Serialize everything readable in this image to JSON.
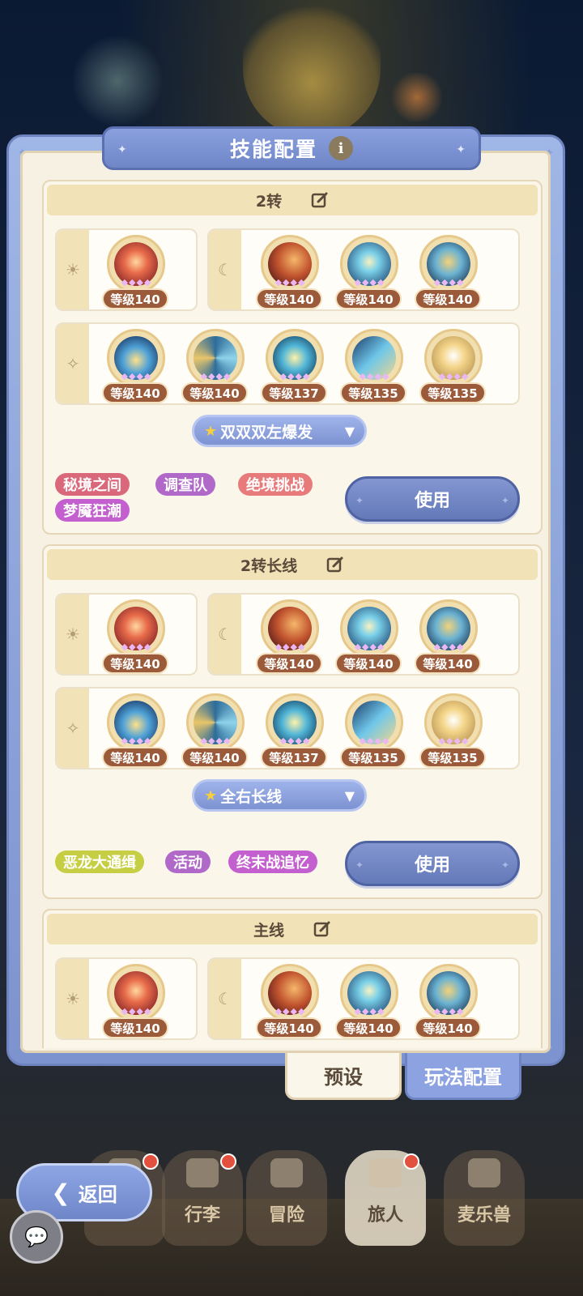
{
  "panel": {
    "title": "技能配置",
    "info_icon": "i"
  },
  "presets": [
    {
      "title": "2转",
      "row1_left": [
        {
          "type": "fire",
          "level": "等级140"
        }
      ],
      "row1_right": [
        {
          "type": "flame",
          "level": "等级140"
        },
        {
          "type": "ice",
          "level": "等级140"
        },
        {
          "type": "gold",
          "level": "等级140"
        }
      ],
      "row2": [
        {
          "type": "wing",
          "level": "等级140"
        },
        {
          "type": "swirl",
          "level": "等级140"
        },
        {
          "type": "water",
          "level": "等级137"
        },
        {
          "type": "blade",
          "level": "等级135"
        },
        {
          "type": "sun",
          "level": "等级135"
        }
      ],
      "dropdown": "双双双左爆发",
      "tags": [
        "秘境之间",
        "调查队",
        "绝境挑战",
        "梦魇狂潮"
      ],
      "use_label": "使用"
    },
    {
      "title": "2转长线",
      "row1_left": [
        {
          "type": "fire",
          "level": "等级140"
        }
      ],
      "row1_right": [
        {
          "type": "flame",
          "level": "等级140"
        },
        {
          "type": "ice",
          "level": "等级140"
        },
        {
          "type": "gold",
          "level": "等级140"
        }
      ],
      "row2": [
        {
          "type": "wing",
          "level": "等级140"
        },
        {
          "type": "swirl",
          "level": "等级140"
        },
        {
          "type": "water",
          "level": "等级137"
        },
        {
          "type": "blade",
          "level": "等级135"
        },
        {
          "type": "sun",
          "level": "等级135"
        }
      ],
      "dropdown": "全右长线",
      "tags": [
        "恶龙大通缉",
        "活动",
        "终末战追忆"
      ],
      "use_label": "使用"
    },
    {
      "title": "主线",
      "row1_left": [
        {
          "type": "fire",
          "level": "等级140"
        }
      ],
      "row1_right": [
        {
          "type": "flame",
          "level": "等级140"
        },
        {
          "type": "ice",
          "level": "等级140"
        },
        {
          "type": "gold",
          "level": "等级140"
        }
      ]
    }
  ],
  "side_icons": {
    "sun": "☀",
    "moon": "☾",
    "star": "✧"
  },
  "tag_colors": {
    "秘境之间": "#d9697a",
    "调查队": "#b068c9",
    "绝境挑战": "#e77b7b",
    "梦魇狂潮": "#c45fcf",
    "恶龙大通缉": "#c6cf43",
    "活动": "#b068c9",
    "终末战追忆": "#c45fcf"
  },
  "mode_tabs": {
    "preset": "预设",
    "gameplay": "玩法配置"
  },
  "nav": [
    "行李",
    "冒险",
    "旅人",
    "麦乐兽"
  ],
  "back_label": "返回"
}
